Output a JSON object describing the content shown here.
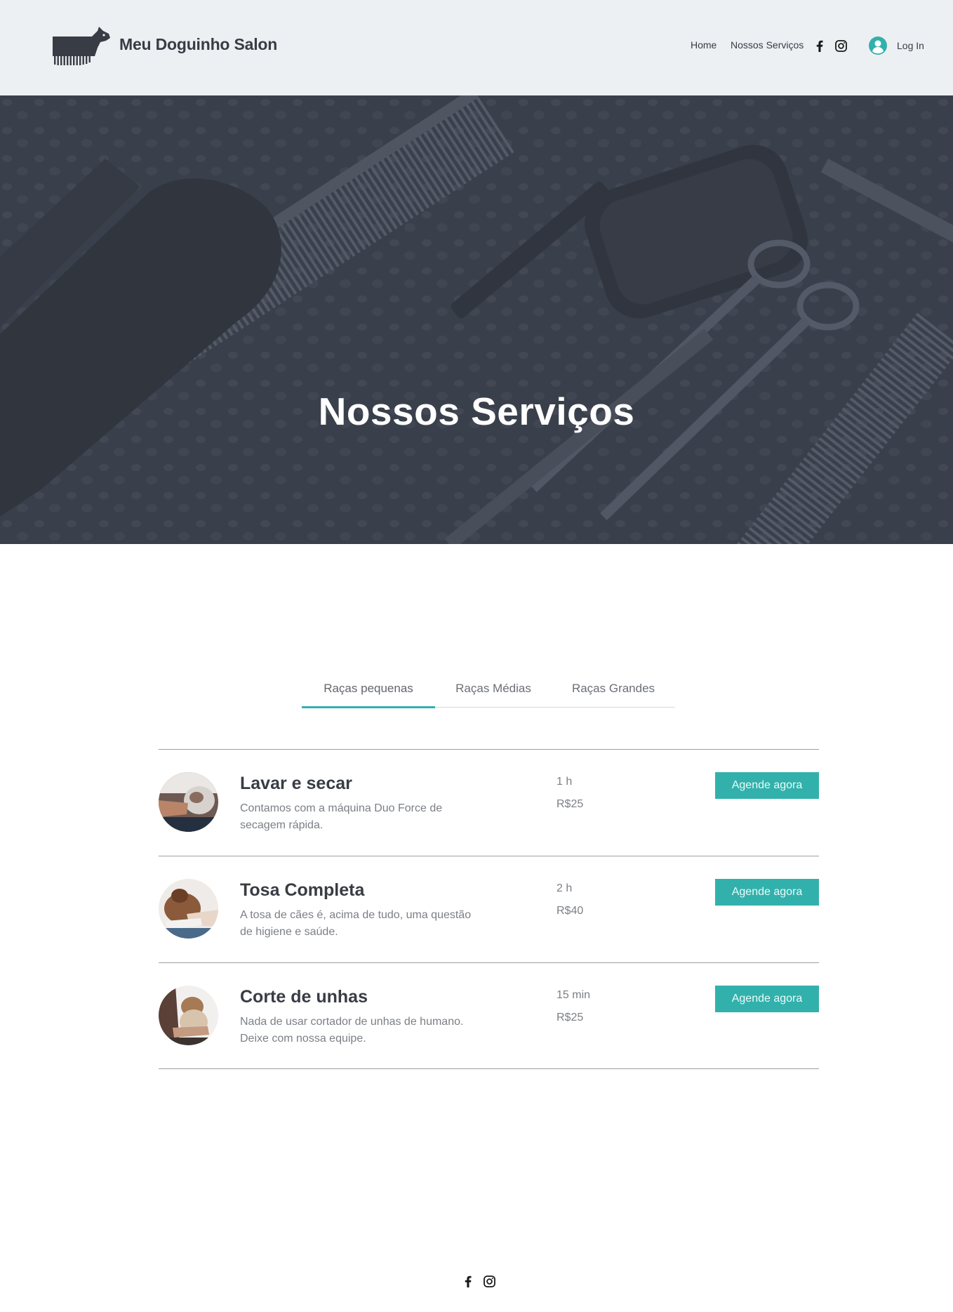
{
  "header": {
    "brand": "Meu Doguinho Salon",
    "logo_icon": "dog-comb-logo",
    "nav": [
      {
        "label": "Home"
      },
      {
        "label": "Nossos Serviços"
      }
    ],
    "social_icons": [
      "facebook-icon",
      "instagram-icon"
    ],
    "login_label": "Log In",
    "background": "#edf0f3"
  },
  "hero": {
    "title": "Nossos Serviços",
    "overlay_color": "#3c414d"
  },
  "tabs": [
    {
      "label": "Raças pequenas",
      "active": true
    },
    {
      "label": "Raças Médias",
      "active": false
    },
    {
      "label": "Raças Grandes",
      "active": false
    }
  ],
  "services": [
    {
      "name": "Lavar e secar",
      "description": "Contamos com a máquina Duo Force de secagem rápida.",
      "duration": "1 h",
      "price": "R$25",
      "button": "Agende agora"
    },
    {
      "name": "Tosa Completa",
      "description": "A tosa de cães é, acima de tudo, uma questão de higiene e saúde.",
      "duration": "2 h",
      "price": "R$40",
      "button": "Agende agora"
    },
    {
      "name": "Corte de unhas",
      "description": "Nada de usar cortador de unhas de humano. Deixe com nossa equipe.",
      "duration": "15 min",
      "price": "R$25",
      "button": "Agende agora"
    }
  ],
  "footer": {
    "social_icons": [
      "facebook-icon",
      "instagram-icon"
    ]
  },
  "colors": {
    "accent": "#32b1ac",
    "text_dark": "#383c44",
    "text_muted": "#7b7f85"
  }
}
